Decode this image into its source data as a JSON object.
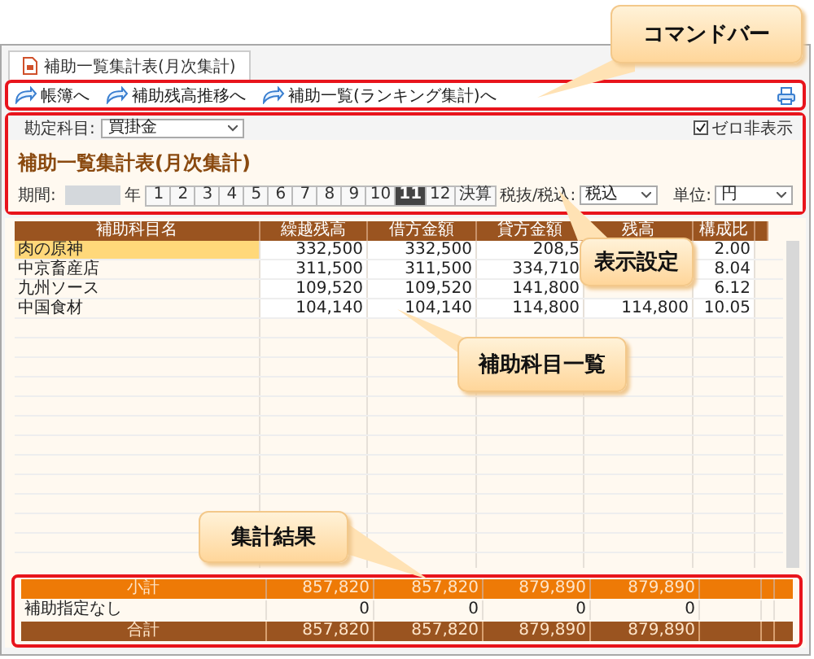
{
  "tab": {
    "title": "補助一覧集計表(月次集計)"
  },
  "command_bar": {
    "items": [
      {
        "label": "帳簿へ"
      },
      {
        "label": "補助残高推移へ"
      },
      {
        "label": "補助一覧(ランキング集計)へ"
      }
    ]
  },
  "settings": {
    "account_label": "勘定科目:",
    "account_value": "買掛金",
    "zero_hide": {
      "label": "ゼロ非表示",
      "checked": true
    },
    "title": "補助一覧集計表(月次集計)",
    "period_label": "期間:",
    "year_suffix": "年",
    "months": [
      {
        "label": "1",
        "selected": false
      },
      {
        "label": "2",
        "selected": false
      },
      {
        "label": "3",
        "selected": false
      },
      {
        "label": "4",
        "selected": false
      },
      {
        "label": "5",
        "selected": false
      },
      {
        "label": "6",
        "selected": false
      },
      {
        "label": "7",
        "selected": false
      },
      {
        "label": "8",
        "selected": false
      },
      {
        "label": "9",
        "selected": false
      },
      {
        "label": "10",
        "selected": false
      },
      {
        "label": "11",
        "selected": true
      },
      {
        "label": "12",
        "selected": false
      },
      {
        "label": "決算",
        "selected": false
      }
    ],
    "tax": {
      "label": "税抜/税込:",
      "value": "税込"
    },
    "unit": {
      "label": "単位:",
      "value": "円"
    }
  },
  "table": {
    "columns": [
      "補助科目名",
      "繰越残高",
      "借方金額",
      "貸方金額",
      "残高",
      "構成比"
    ],
    "rows": [
      {
        "name": "肉の原神",
        "carryover": "332,500",
        "debit": "332,500",
        "credit": "208,5",
        "ratio": "2.00",
        "selected": true
      },
      {
        "name": "中京畜産店",
        "carryover": "311,500",
        "debit": "311,500",
        "credit": "334,710",
        "ratio": "8.04",
        "selected": false
      },
      {
        "name": "九州ソース",
        "carryover": "109,520",
        "debit": "109,520",
        "credit": "141,800",
        "ratio": "6.12",
        "selected": false
      },
      {
        "name": "中国食材",
        "carryover": "104,140",
        "debit": "104,140",
        "credit": "114,800",
        "balance": "114,800",
        "ratio": "10.05",
        "selected": false
      }
    ]
  },
  "summary": [
    {
      "kind": "subtotal",
      "label": "小計",
      "values": [
        "857,820",
        "857,820",
        "879,890",
        "879,890"
      ]
    },
    {
      "kind": "plain",
      "label": "補助指定なし",
      "values": [
        "0",
        "0",
        "0",
        "0"
      ]
    },
    {
      "kind": "total",
      "label": "合計",
      "values": [
        "857,820",
        "857,820",
        "879,890",
        "879,890"
      ]
    }
  ],
  "callouts": [
    {
      "text": "コマンドバー"
    },
    {
      "text": "表示設定"
    },
    {
      "text": "補助科目一覧"
    },
    {
      "text": "集計結果"
    }
  ]
}
